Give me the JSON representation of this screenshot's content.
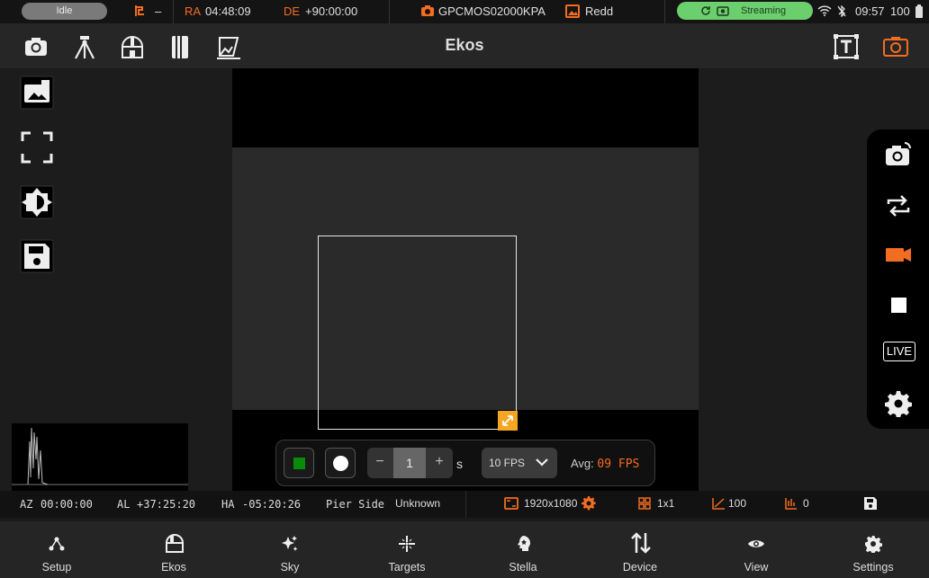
{
  "status": {
    "idle_label": "Idle",
    "mount_value": "–",
    "ra_label": "RA",
    "ra_value": "04:48:09",
    "de_label": "DE",
    "de_value": "+90:00:00",
    "camera_name": "GPCMOS02000KPA",
    "image_name": "Redd",
    "streaming_label": "Streaming",
    "clock": "09:57",
    "battery": "100"
  },
  "toolbar": {
    "title": "Ekos"
  },
  "controls": {
    "exposure_value": "1",
    "exposure_minus": "−",
    "exposure_plus": "+",
    "exposure_unit": "s",
    "fps_selected": "10 FPS",
    "avg_label": "Avg:",
    "avg_value": "09 FPS"
  },
  "right_panel": {
    "live_label": "LIVE"
  },
  "info": {
    "az_label": "AZ",
    "az_value": "00:00:00",
    "al_label": "AL",
    "al_value": "+37:25:20",
    "ha_label": "HA",
    "ha_value": "-05:20:26",
    "pier_label": "Pier Side",
    "pier_value": "Unknown",
    "resolution": "1920x1080",
    "binning": "1x1",
    "gain": "100",
    "offset": "0"
  },
  "nav": [
    {
      "label": "Setup"
    },
    {
      "label": "Ekos"
    },
    {
      "label": "Sky"
    },
    {
      "label": "Targets"
    },
    {
      "label": "Stella"
    },
    {
      "label": "Device"
    },
    {
      "label": "View"
    },
    {
      "label": "Settings"
    }
  ],
  "colors": {
    "accent": "#f26d21",
    "stream": "#6ccf6e",
    "roi_handle": "#f5a623"
  }
}
